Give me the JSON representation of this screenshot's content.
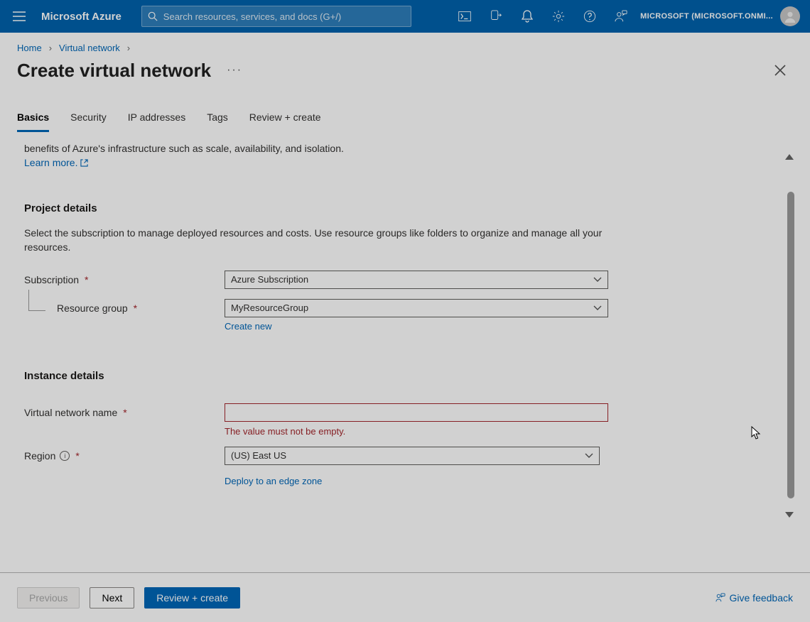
{
  "header": {
    "brand": "Microsoft Azure",
    "search_placeholder": "Search resources, services, and docs (G+/)",
    "tenant": "MICROSOFT (MICROSOFT.ONMI..."
  },
  "breadcrumb": {
    "home": "Home",
    "vnet": "Virtual network"
  },
  "page": {
    "title": "Create virtual network"
  },
  "tabs": {
    "basics": "Basics",
    "security": "Security",
    "ip": "IP addresses",
    "tags": "Tags",
    "review": "Review + create"
  },
  "intro": {
    "line": "benefits of Azure's infrastructure such as scale, availability, and isolation.",
    "learn_more": "Learn more."
  },
  "project": {
    "title": "Project details",
    "desc": "Select the subscription to manage deployed resources and costs. Use resource groups like folders to organize and manage all your resources.",
    "subscription_label": "Subscription",
    "subscription_value": "Azure Subscription",
    "rg_label": "Resource group",
    "rg_value": "MyResourceGroup",
    "create_new": "Create new"
  },
  "instance": {
    "title": "Instance details",
    "name_label": "Virtual network name",
    "name_value": "",
    "name_error": "The value must not be empty.",
    "region_label": "Region",
    "region_value": "(US) East US",
    "edge_link": "Deploy to an edge zone"
  },
  "footer": {
    "previous": "Previous",
    "next": "Next",
    "review": "Review + create",
    "feedback": "Give feedback"
  }
}
